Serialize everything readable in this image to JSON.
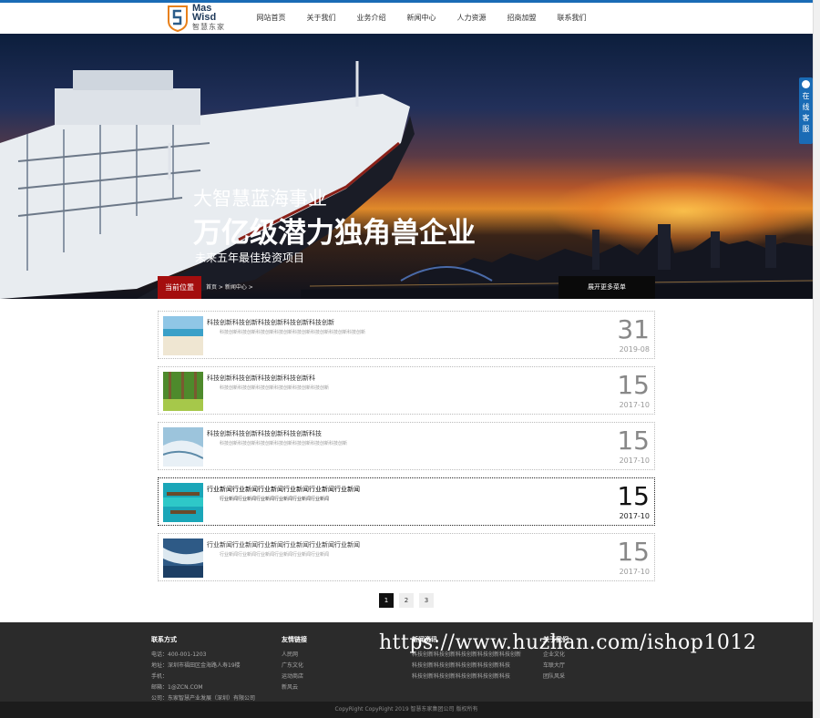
{
  "header": {
    "logo_line1": "Mas",
    "logo_line2": "Wisd",
    "logo_sub": "智慧东家",
    "nav": [
      "网站首页",
      "关于我们",
      "业务介绍",
      "新闻中心",
      "人力资源",
      "招商加盟",
      "联系我们"
    ]
  },
  "banner": {
    "line1": "大智慧蓝海事业",
    "line2": "万亿级潜力独角兽企业",
    "line3": "未来五年最佳投资项目"
  },
  "side_service": {
    "label": "在线客服"
  },
  "breadcrumb": {
    "tag": "当前位置",
    "path": "首页 > 新闻中心 >",
    "button": "展开更多菜单"
  },
  "news": [
    {
      "title": "科技创新科技创新科技创新科技创新科技创新",
      "desc": "科技创新科技创新科技创新科技创新科技创新科技创新科技创新科技创新",
      "day": "31",
      "ym": "2019-08",
      "thumb": "beach-icon"
    },
    {
      "title": "科技创新科技创新科技创新科技创新科",
      "desc": "科技创新科技创新科技创新科技创新科技创新科技创新",
      "day": "15",
      "ym": "2017-10",
      "thumb": "forest-icon"
    },
    {
      "title": "科技创新科技创新科技创新科技创新科技",
      "desc": "科技创新科技创新科技创新科技创新科技创新科技创新科技创新",
      "day": "15",
      "ym": "2017-10",
      "thumb": "ice-icon"
    },
    {
      "title": "行业新闻行业新闻行业新闻行业新闻行业新闻行业新闻",
      "desc": "行业新闻行业新闻行业新闻行业新闻行业新闻行业新闻",
      "day": "15",
      "ym": "2017-10",
      "thumb": "lagoon-icon"
    },
    {
      "title": "行业新闻行业新闻行业新闻行业新闻行业新闻行业新闻",
      "desc": "行业新闻行业新闻行业新闻行业新闻行业新闻行业新闻",
      "day": "15",
      "ym": "2017-10",
      "thumb": "coast-icon"
    }
  ],
  "pagination": [
    "1",
    "2",
    "3"
  ],
  "footer": {
    "contact": {
      "head": "联系方式",
      "rows": [
        "电话：400-001-1203",
        "地址：深圳市福田区金海路人寿19楼",
        "手机：",
        "邮箱：1@ZCN.COM",
        "公司：东家智慧产业发展（深圳）有限公司"
      ]
    },
    "links": {
      "head": "友情链接",
      "rows": [
        "人民网",
        "广东文化",
        "运动商店",
        "新风云"
      ]
    },
    "products": {
      "head": "新闻资讯",
      "rows": [
        "科技创新科技创新科技创新科技创新科技创新",
        "科技创新科技创新科技创新科技创新科技",
        "科技创新科技创新科技创新科技创新科技"
      ]
    },
    "about": {
      "head": "关于我们",
      "rows": [
        "企业文化",
        "车联大厅",
        "团队风采"
      ]
    },
    "copyright": "CopyRight CopyRight 2019 智慧东家集团公司 版权所有"
  },
  "watermark": "https://www.huzhan.com/ishop1012",
  "colors": {
    "top_line": "#1a6bb5",
    "crumb_tag": "#a40e0e",
    "footer": "#2b2b2b"
  }
}
